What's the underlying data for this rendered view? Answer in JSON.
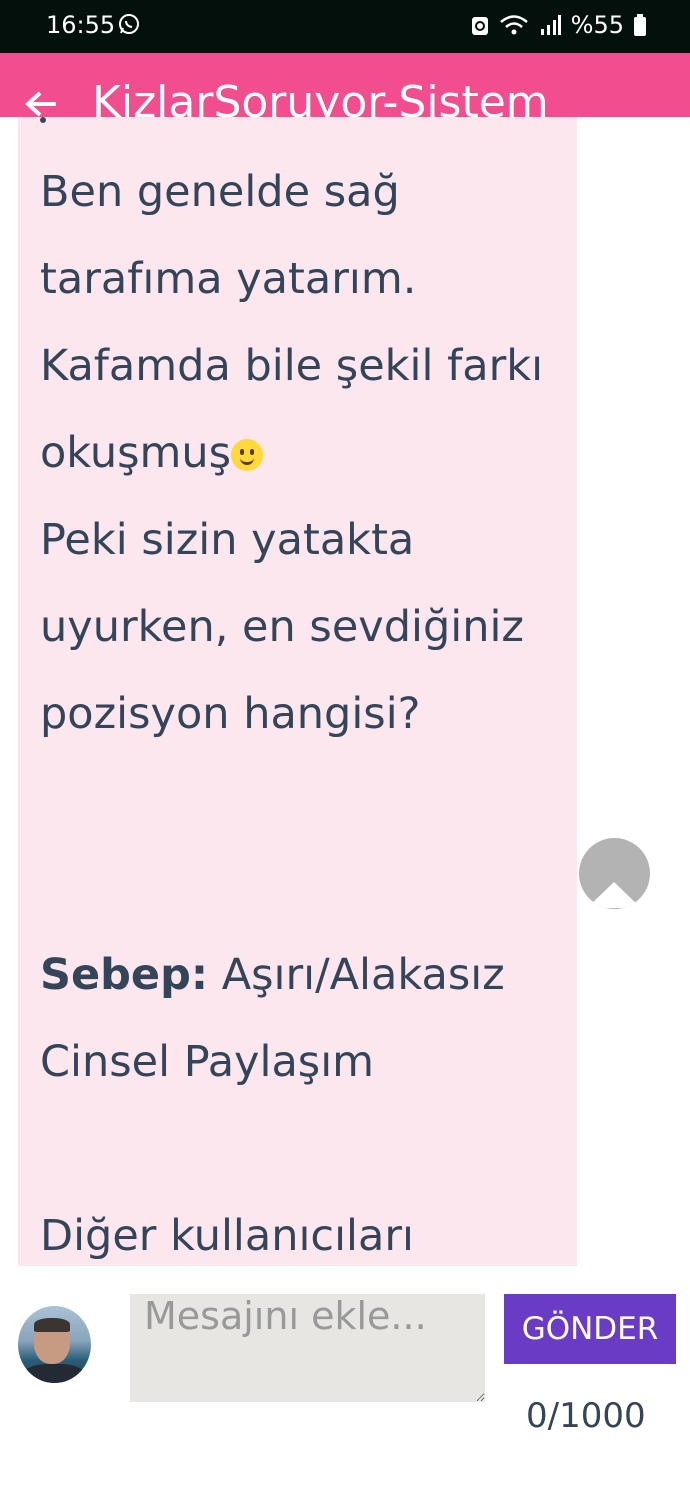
{
  "status_bar": {
    "time": "16:55",
    "battery": "%55",
    "icons": [
      "whatsapp-icon",
      "recycle-icon",
      "wifi-icon",
      "signal-icon",
      "battery-icon"
    ]
  },
  "app_bar": {
    "title": "KizlarSoruyor-Sistem",
    "back_icon": "arrow-left-icon",
    "color": "#f24d8f"
  },
  "message": {
    "paragraph_1": "Ben genelde sağ tarafıma yatarım. Kafamda bile şekil farkı okuşmuş",
    "emoji": "slightly-smiling-face-icon",
    "paragraph_2": "Peki sizin yatakta uyurken, en sevdiğiniz pozisyon hangisi?",
    "reason_label": "Sebep:",
    "reason_text": "Aşırı/Alakasız Cinsel Paylaşım",
    "paragraph_3": "Diğer kullanıcıları",
    "bubble_color": "#fde7ef"
  },
  "scroll_top_icon": "chevron-up-icon",
  "composer": {
    "placeholder": "Mesajını ekle...",
    "value": "",
    "send_label": "GÖNDER",
    "counter": "0/1000",
    "send_color": "#6a3bc4"
  }
}
